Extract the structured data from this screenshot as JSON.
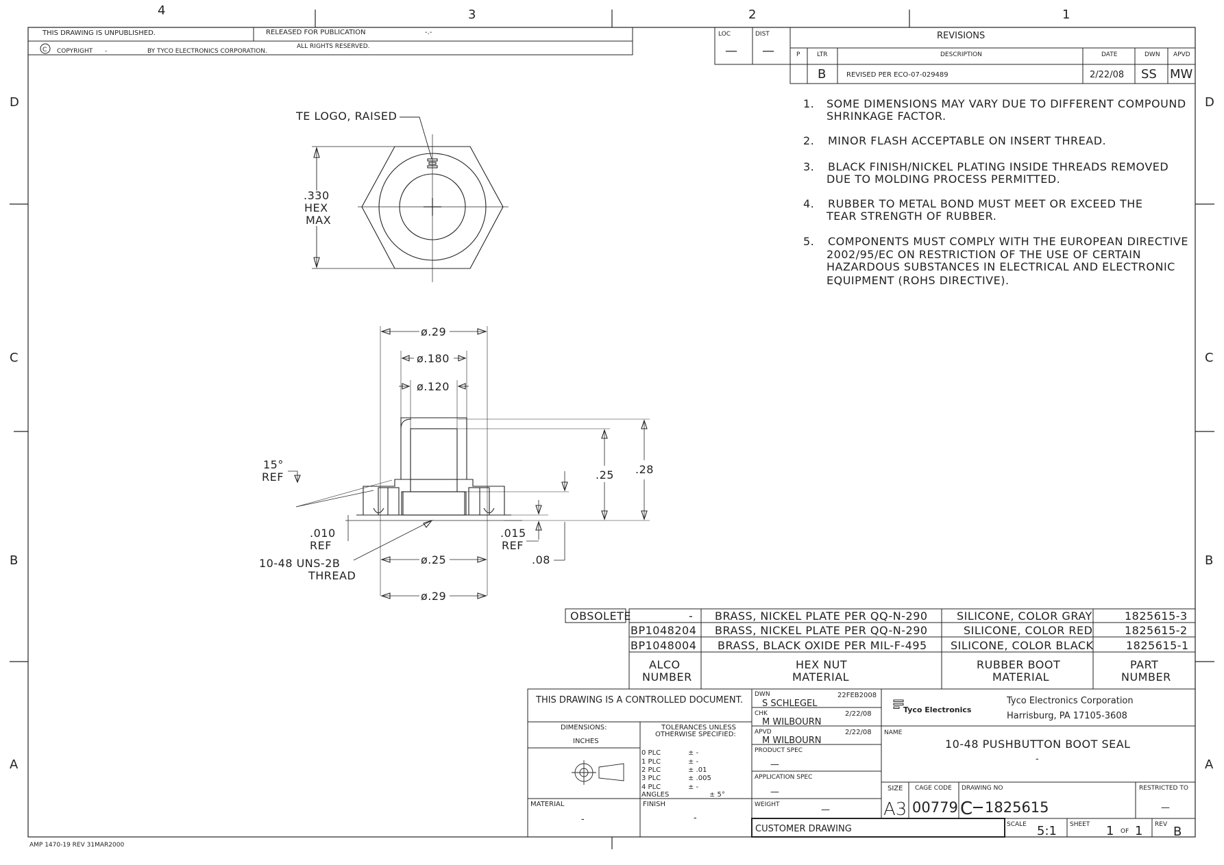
{
  "zones": {
    "top": [
      "4",
      "3",
      "2",
      "1"
    ],
    "side": [
      "D",
      "C",
      "B",
      "A"
    ]
  },
  "header": {
    "unpublished": "THIS DRAWING IS UNPUBLISHED.",
    "released": "RELEASED FOR PUBLICATION",
    "release_date": "-.-",
    "copyright_symbol": "C",
    "copyright": "COPYRIGHT",
    "copyright_dash": "-",
    "by": "BY TYCO ELECTRONICS CORPORATION.",
    "rights": "ALL RIGHTS RESERVED."
  },
  "loc_dist": {
    "loc_label": "LOC",
    "loc_value": "—",
    "dist_label": "DIST",
    "dist_value": "—"
  },
  "revisions": {
    "title": "REVISIONS",
    "headers": [
      "P",
      "LTR",
      "DESCRIPTION",
      "DATE",
      "DWN",
      "APVD"
    ],
    "row": {
      "p": "",
      "ltr": "B",
      "description": "REVISED PER ECO-07-029489",
      "date": "2/22/08",
      "dwn": "SS",
      "apvd": "MW"
    }
  },
  "notes": [
    {
      "num": "1.",
      "lines": [
        "SOME DIMENSIONS MAY VARY DUE TO DIFFERENT COMPOUND",
        "SHRINKAGE FACTOR."
      ]
    },
    {
      "num": "2.",
      "lines": [
        "MINOR FLASH ACCEPTABLE ON INSERT THREAD."
      ]
    },
    {
      "num": "3.",
      "lines": [
        "BLACK FINISH/NICKEL PLATING INSIDE THREADS REMOVED",
        "DUE TO MOLDING PROCESS PERMITTED."
      ]
    },
    {
      "num": "4.",
      "lines": [
        "RUBBER TO METAL BOND MUST MEET OR EXCEED THE",
        "TEAR STRENGTH OF RUBBER."
      ]
    },
    {
      "num": "5.",
      "lines": [
        "COMPONENTS MUST COMPLY WITH THE EUROPEAN DIRECTIVE",
        "2002/95/EC ON RESTRICTION OF THE USE OF CERTAIN",
        "HAZARDOUS SUBSTANCES IN ELECTRICAL AND ELECTRONIC",
        "EQUIPMENT (ROHS DIRECTIVE)."
      ]
    }
  ],
  "top_view": {
    "logo_label": "TE LOGO, RAISED",
    "hex_dim": [
      ".330",
      "HEX",
      "MAX"
    ]
  },
  "section_view": {
    "dia_029_top": "ø.29",
    "dia_0180": "ø.180",
    "dia_0120": "ø.120",
    "angle": [
      "15°",
      "REF"
    ],
    "dim_025": ".25",
    "dim_028": ".28",
    "dim_010": [
      ".010",
      "REF"
    ],
    "dim_015": [
      ".015",
      "REF"
    ],
    "thread": [
      "10-48 UNS-2B",
      "THREAD"
    ],
    "dia_025": "ø.25",
    "dim_008": ".08",
    "dia_029_bottom": "ø.29"
  },
  "parts_table": {
    "rows": [
      {
        "status": "OBSOLETE",
        "alco": "-",
        "hex": "BRASS, NICKEL PLATE PER QQ-N-290",
        "boot": "SILICONE, COLOR GRAY",
        "part": "1825615-3"
      },
      {
        "status": "",
        "alco": "BP1048204",
        "hex": "BRASS, NICKEL PLATE PER QQ-N-290",
        "boot": "SILICONE, COLOR RED",
        "part": "1825615-2"
      },
      {
        "status": "",
        "alco": "BP1048004",
        "hex": "BRASS, BLACK OXIDE PER MIL-F-495",
        "boot": "SILICONE, COLOR BLACK",
        "part": "1825615-1"
      }
    ],
    "headers": {
      "alco": [
        "ALCO",
        "NUMBER"
      ],
      "hex": [
        "HEX NUT",
        "MATERIAL"
      ],
      "boot": [
        "RUBBER BOOT",
        "MATERIAL"
      ],
      "part": [
        "PART",
        "NUMBER"
      ]
    }
  },
  "title_block": {
    "controlled": "THIS DRAWING IS A CONTROLLED DOCUMENT.",
    "dimensions_label": "DIMENSIONS:",
    "dimensions_unit": "INCHES",
    "tolerances": [
      "TOLERANCES UNLESS",
      "OTHERWISE SPECIFIED:"
    ],
    "tol_rows": [
      {
        "label": "0 PLC",
        "value": "± -"
      },
      {
        "label": "1 PLC",
        "value": "± -"
      },
      {
        "label": "2 PLC",
        "value": "± .01"
      },
      {
        "label": "3 PLC",
        "value": "± .005"
      },
      {
        "label": "4 PLC",
        "value": "± -"
      },
      {
        "label": "ANGLES",
        "value": "± 5°"
      }
    ],
    "material_label": "MATERIAL",
    "material_value": "-",
    "finish_label": "FINISH",
    "finish_value": "-",
    "dwn_label": "DWN",
    "dwn_name": "S SCHLEGEL",
    "dwn_date": "22FEB2008",
    "chk_label": "CHK",
    "chk_name": "M WILBOURN",
    "chk_date": "2/22/08",
    "apvd_label": "APVD",
    "apvd_name": "M WILBOURN",
    "apvd_date": "2/22/08",
    "product_spec_label": "PRODUCT SPEC",
    "product_spec_value": "—",
    "application_spec_label": "APPLICATION SPEC",
    "application_spec_value": "—",
    "weight_label": "WEIGHT",
    "weight_value": "—",
    "customer_drawing": "CUSTOMER DRAWING",
    "company_logo": "Tyco Electronics",
    "company_name": "Tyco Electronics Corporation",
    "company_address": "Harrisburg, PA 17105-3608",
    "name_label": "NAME",
    "name_value": "10-48 PUSHBUTTON BOOT SEAL",
    "name_dash": "-",
    "size_label": "SIZE",
    "size_value": "A3",
    "cage_label": "CAGE CODE",
    "cage_value": "00779",
    "drawing_no_label": "DRAWING NO",
    "drawing_no_prefix": "C",
    "drawing_no_value": "1825615",
    "restricted_label": "RESTRICTED TO",
    "restricted_value": "—",
    "scale_label": "SCALE",
    "scale_value": "5:1",
    "sheet_label": "SHEET",
    "sheet_value": "1",
    "sheet_of": "OF",
    "sheet_total": "1",
    "rev_label": "REV",
    "rev_value": "B"
  },
  "footer": {
    "form": "AMP 1470-19 REV 31MAR2000"
  }
}
